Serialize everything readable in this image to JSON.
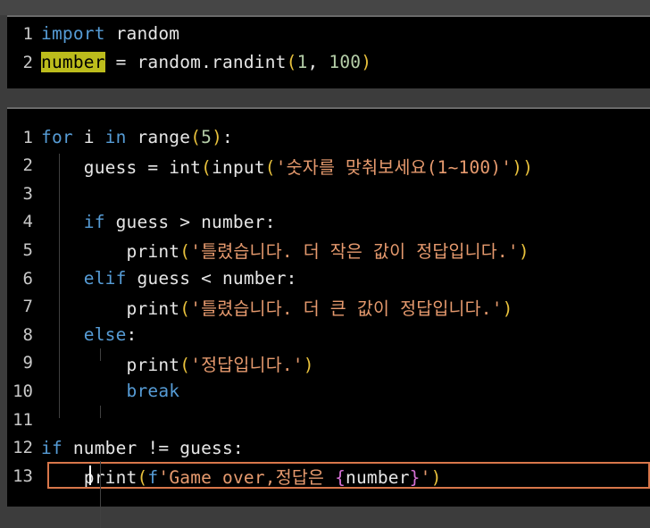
{
  "editor": {
    "cell1": {
      "lines": [
        {
          "n": "1",
          "tokens": [
            [
              "kw",
              "import"
            ],
            [
              "var",
              " random"
            ]
          ]
        },
        {
          "n": "2",
          "tokens": [
            [
              "hl",
              "number"
            ],
            [
              "var",
              " = random.randint"
            ],
            [
              "paren",
              "("
            ],
            [
              "num",
              "1"
            ],
            [
              "var",
              ", "
            ],
            [
              "num",
              "100"
            ],
            [
              "paren",
              ")"
            ]
          ]
        }
      ]
    },
    "cell2": {
      "lines": [
        {
          "n": "1",
          "tokens": [
            [
              "kw",
              "for"
            ],
            [
              "var",
              " i "
            ],
            [
              "kw",
              "in"
            ],
            [
              "var",
              " range"
            ],
            [
              "paren",
              "("
            ],
            [
              "num",
              "5"
            ],
            [
              "paren",
              ")"
            ],
            [
              "var",
              ":"
            ]
          ]
        },
        {
          "n": "2",
          "tokens": [
            [
              "var",
              "    guess = int"
            ],
            [
              "paren",
              "("
            ],
            [
              "var",
              "input"
            ],
            [
              "paren",
              "("
            ],
            [
              "str",
              "'숫자를 맞춰보세요(1~100)'"
            ],
            [
              "paren",
              "))"
            ]
          ]
        },
        {
          "n": "3",
          "tokens": []
        },
        {
          "n": "4",
          "tokens": [
            [
              "var",
              "    "
            ],
            [
              "kw",
              "if"
            ],
            [
              "var",
              " guess > number:"
            ]
          ]
        },
        {
          "n": "5",
          "tokens": [
            [
              "var",
              "        print"
            ],
            [
              "paren",
              "("
            ],
            [
              "str",
              "'틀렸습니다. 더 작은 값이 정답입니다.'"
            ],
            [
              "paren",
              ")"
            ]
          ]
        },
        {
          "n": "6",
          "tokens": [
            [
              "var",
              "    "
            ],
            [
              "kw",
              "elif"
            ],
            [
              "var",
              " guess < number:"
            ]
          ]
        },
        {
          "n": "7",
          "tokens": [
            [
              "var",
              "        print"
            ],
            [
              "paren",
              "("
            ],
            [
              "str",
              "'틀렸습니다. 더 큰 값이 정답입니다.'"
            ],
            [
              "paren",
              ")"
            ]
          ]
        },
        {
          "n": "8",
          "tokens": [
            [
              "var",
              "    "
            ],
            [
              "kw",
              "else"
            ],
            [
              "var",
              ":"
            ]
          ]
        },
        {
          "n": "9",
          "tokens": [
            [
              "var",
              "        print"
            ],
            [
              "paren",
              "("
            ],
            [
              "str",
              "'정답입니다.'"
            ],
            [
              "paren",
              ")"
            ]
          ]
        },
        {
          "n": "10",
          "tokens": [
            [
              "var",
              "        "
            ],
            [
              "kw",
              "break"
            ]
          ]
        },
        {
          "n": "11",
          "tokens": []
        },
        {
          "n": "12",
          "tokens": [
            [
              "kw",
              "if"
            ],
            [
              "var",
              " number != guess:"
            ]
          ]
        },
        {
          "n": "13",
          "tokens": [
            [
              "var",
              "    print"
            ],
            [
              "paren",
              "("
            ],
            [
              "kw",
              "f"
            ],
            [
              "str",
              "'Game over,정답은 "
            ],
            [
              "brace",
              "{"
            ],
            [
              "var",
              "number"
            ],
            [
              "brace",
              "}"
            ],
            [
              "str",
              "'"
            ],
            [
              "paren",
              ")"
            ]
          ]
        }
      ]
    }
  },
  "colors": {
    "keyword": "#569cd6",
    "string": "#e69a6e",
    "number": "#b5cea8",
    "paren": "#e8c13c",
    "highlight": "#bcbc1c",
    "current_line_border": "#d8764a"
  }
}
